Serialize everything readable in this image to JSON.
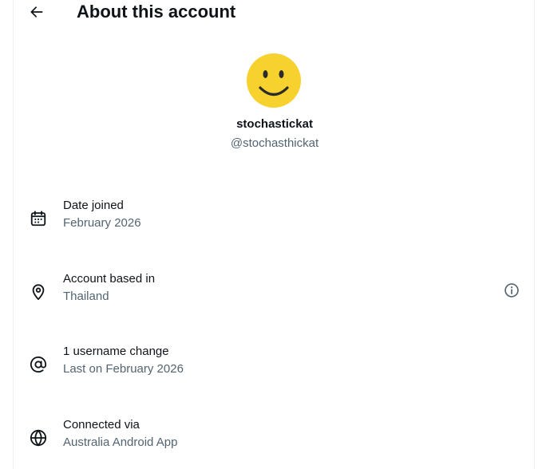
{
  "header": {
    "title": "About this account",
    "back_icon": "arrow-left-icon"
  },
  "profile": {
    "display_name": "stochastickat",
    "handle": "@stochasthickat",
    "avatar_icon": "smiley-face-icon",
    "avatar_color": "#f7d12e"
  },
  "details": [
    {
      "icon": "calendar-icon",
      "label": "Date joined",
      "value": "February 2026"
    },
    {
      "icon": "location-pin-icon",
      "label": "Account based in",
      "value": "Thailand",
      "info_icon": "info-icon"
    },
    {
      "icon": "at-sign-icon",
      "label": "1 username change",
      "value": "Last on February 2026"
    },
    {
      "icon": "globe-icon",
      "label": "Connected via",
      "value": "Australia Android App"
    }
  ]
}
